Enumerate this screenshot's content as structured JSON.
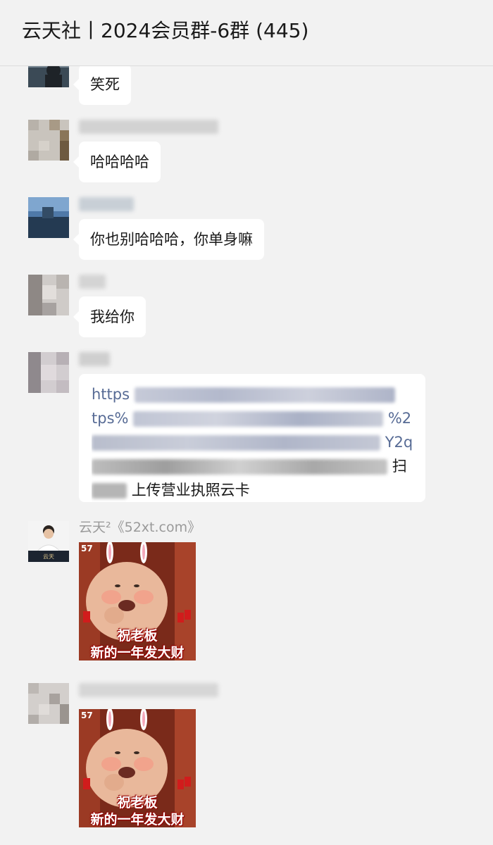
{
  "header": {
    "title": "云天社丨2024会员群-6群 (445)"
  },
  "messages": [
    {
      "type": "text",
      "text": "笑死"
    },
    {
      "type": "text",
      "text": "哈哈哈哈"
    },
    {
      "type": "text",
      "text": "你也别哈哈哈，你单身嘛"
    },
    {
      "type": "text",
      "text": "我给你"
    },
    {
      "type": "link",
      "line1_visible": "https",
      "line2_visible": "tps%",
      "line2_end": "%2",
      "line3_end": "Y2q",
      "line4_end": "扫",
      "line5_text": "上传营业执照云卡"
    },
    {
      "type": "sticker",
      "sender": "云天²《52xt.com》",
      "badge": "57",
      "caption1": "祝老板",
      "caption2": "新的一年发大财"
    },
    {
      "type": "sticker",
      "badge": "57",
      "caption1": "祝老板",
      "caption2": "新的一年发大财"
    }
  ],
  "avatars": {
    "yuntian_sig": "云天"
  },
  "colors": {
    "background": "#f2f2f2",
    "bubble": "#ffffff",
    "link": "#576b95",
    "sender_name": "#9a9a9a"
  }
}
